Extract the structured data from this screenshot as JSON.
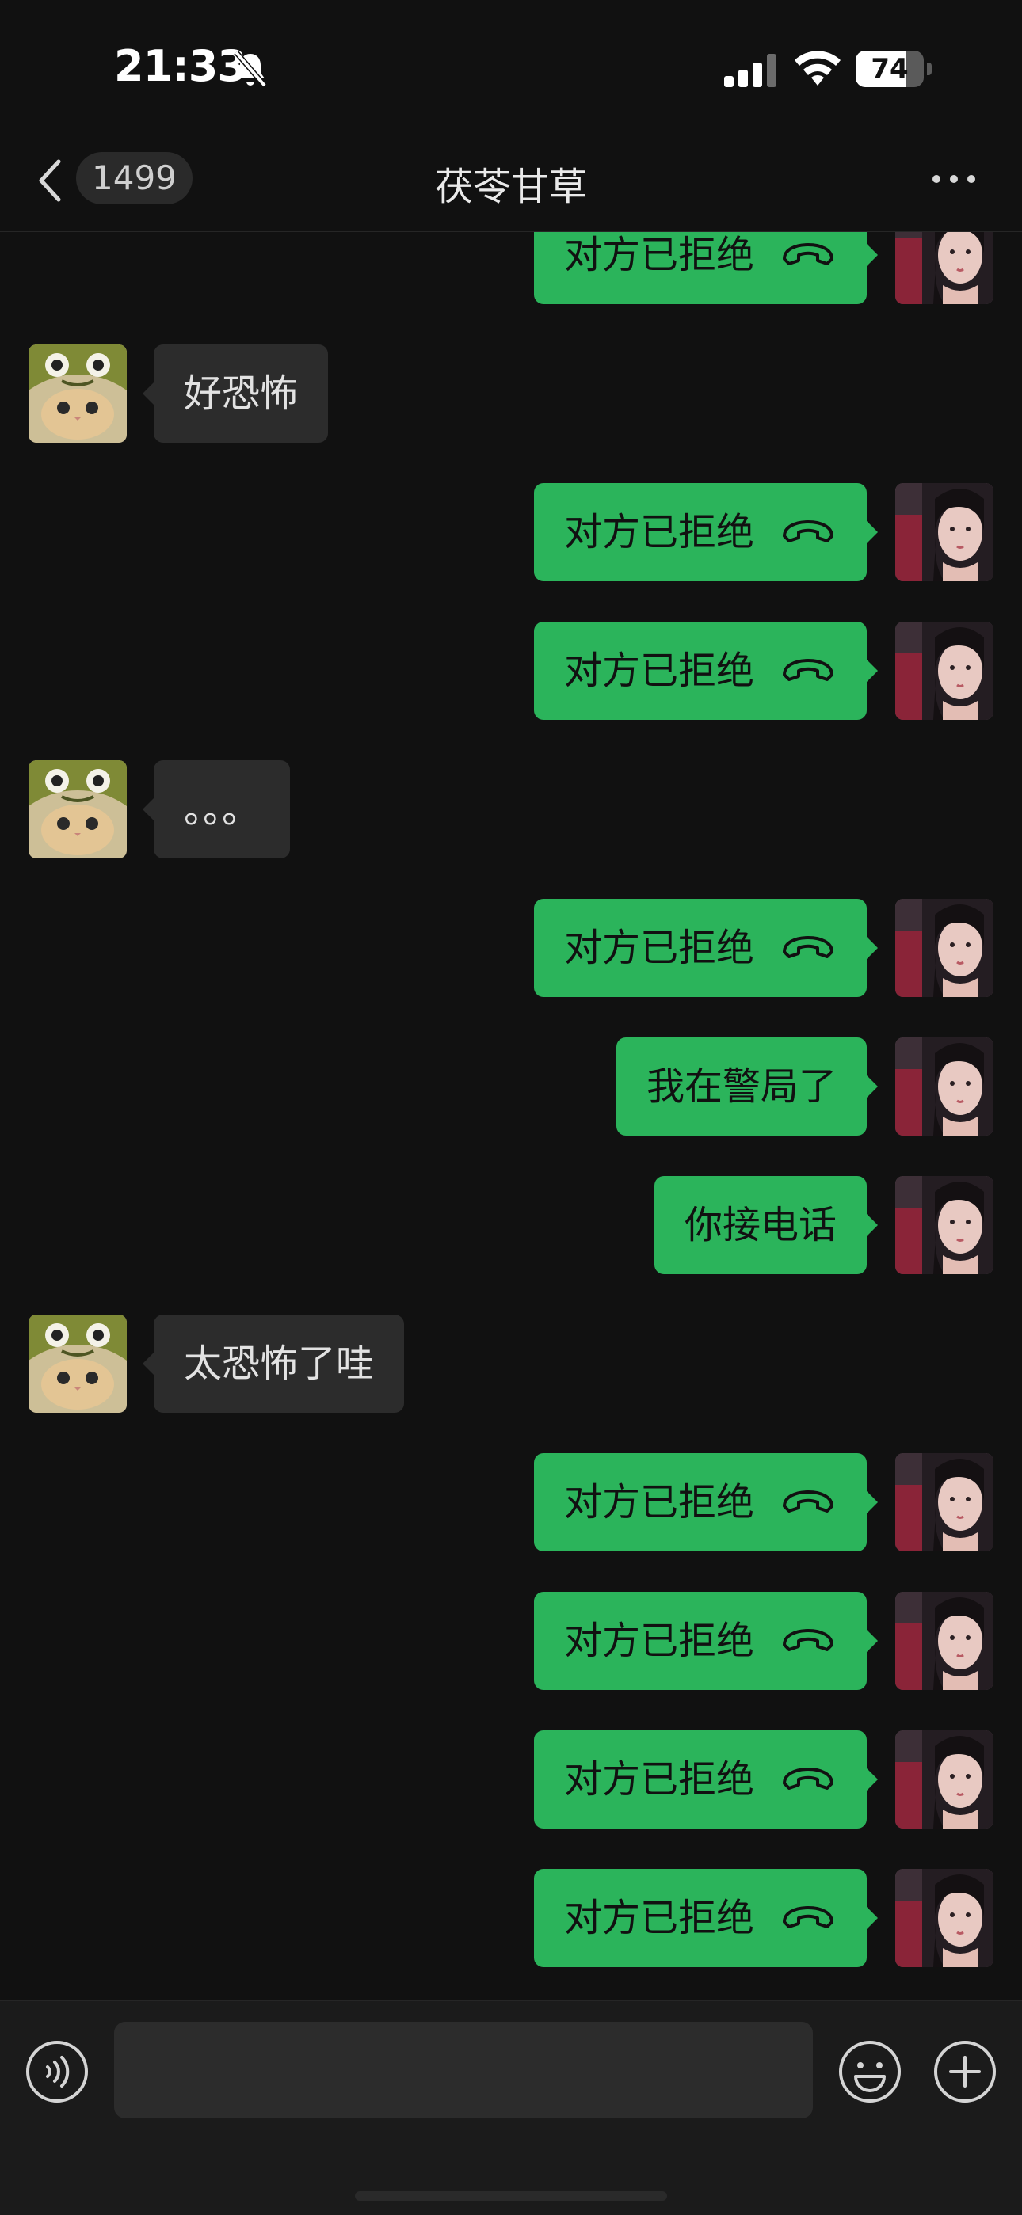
{
  "status_bar": {
    "time": "21:33",
    "battery_percent": "74",
    "battery_level": 0.74,
    "icons": [
      "bell-off-icon",
      "cellular-signal-icon",
      "wifi-icon",
      "battery-icon"
    ]
  },
  "nav": {
    "back_icon": "chevron-left-icon",
    "unread_count": "1499",
    "title": "茯苓甘草",
    "more_icon": "more-dots-icon"
  },
  "messages": [
    {
      "side": "out",
      "text": "对方已拒绝",
      "type": "call"
    },
    {
      "side": "in",
      "text": "好恐怖",
      "type": "text"
    },
    {
      "side": "out",
      "text": "对方已拒绝",
      "type": "call"
    },
    {
      "side": "out",
      "text": "对方已拒绝",
      "type": "call"
    },
    {
      "side": "in",
      "text": "。。。",
      "type": "text"
    },
    {
      "side": "out",
      "text": "对方已拒绝",
      "type": "call"
    },
    {
      "side": "out",
      "text": "我在警局了",
      "type": "text"
    },
    {
      "side": "out",
      "text": "你接电话",
      "type": "text"
    },
    {
      "side": "in",
      "text": "太恐怖了哇",
      "type": "text"
    },
    {
      "side": "out",
      "text": "对方已拒绝",
      "type": "call"
    },
    {
      "side": "out",
      "text": "对方已拒绝",
      "type": "call"
    },
    {
      "side": "out",
      "text": "对方已拒绝",
      "type": "call"
    },
    {
      "side": "out",
      "text": "对方已拒绝",
      "type": "call"
    }
  ],
  "input_bar": {
    "voice_icon": "voice-input-icon",
    "text_value": "",
    "emoji_icon": "emoji-icon",
    "plus_icon": "plus-icon"
  },
  "colors": {
    "background": "#111111",
    "outgoing_bubble": "#2bb45b",
    "incoming_bubble": "#2c2c2c",
    "input_bar": "#1b1b1b"
  }
}
